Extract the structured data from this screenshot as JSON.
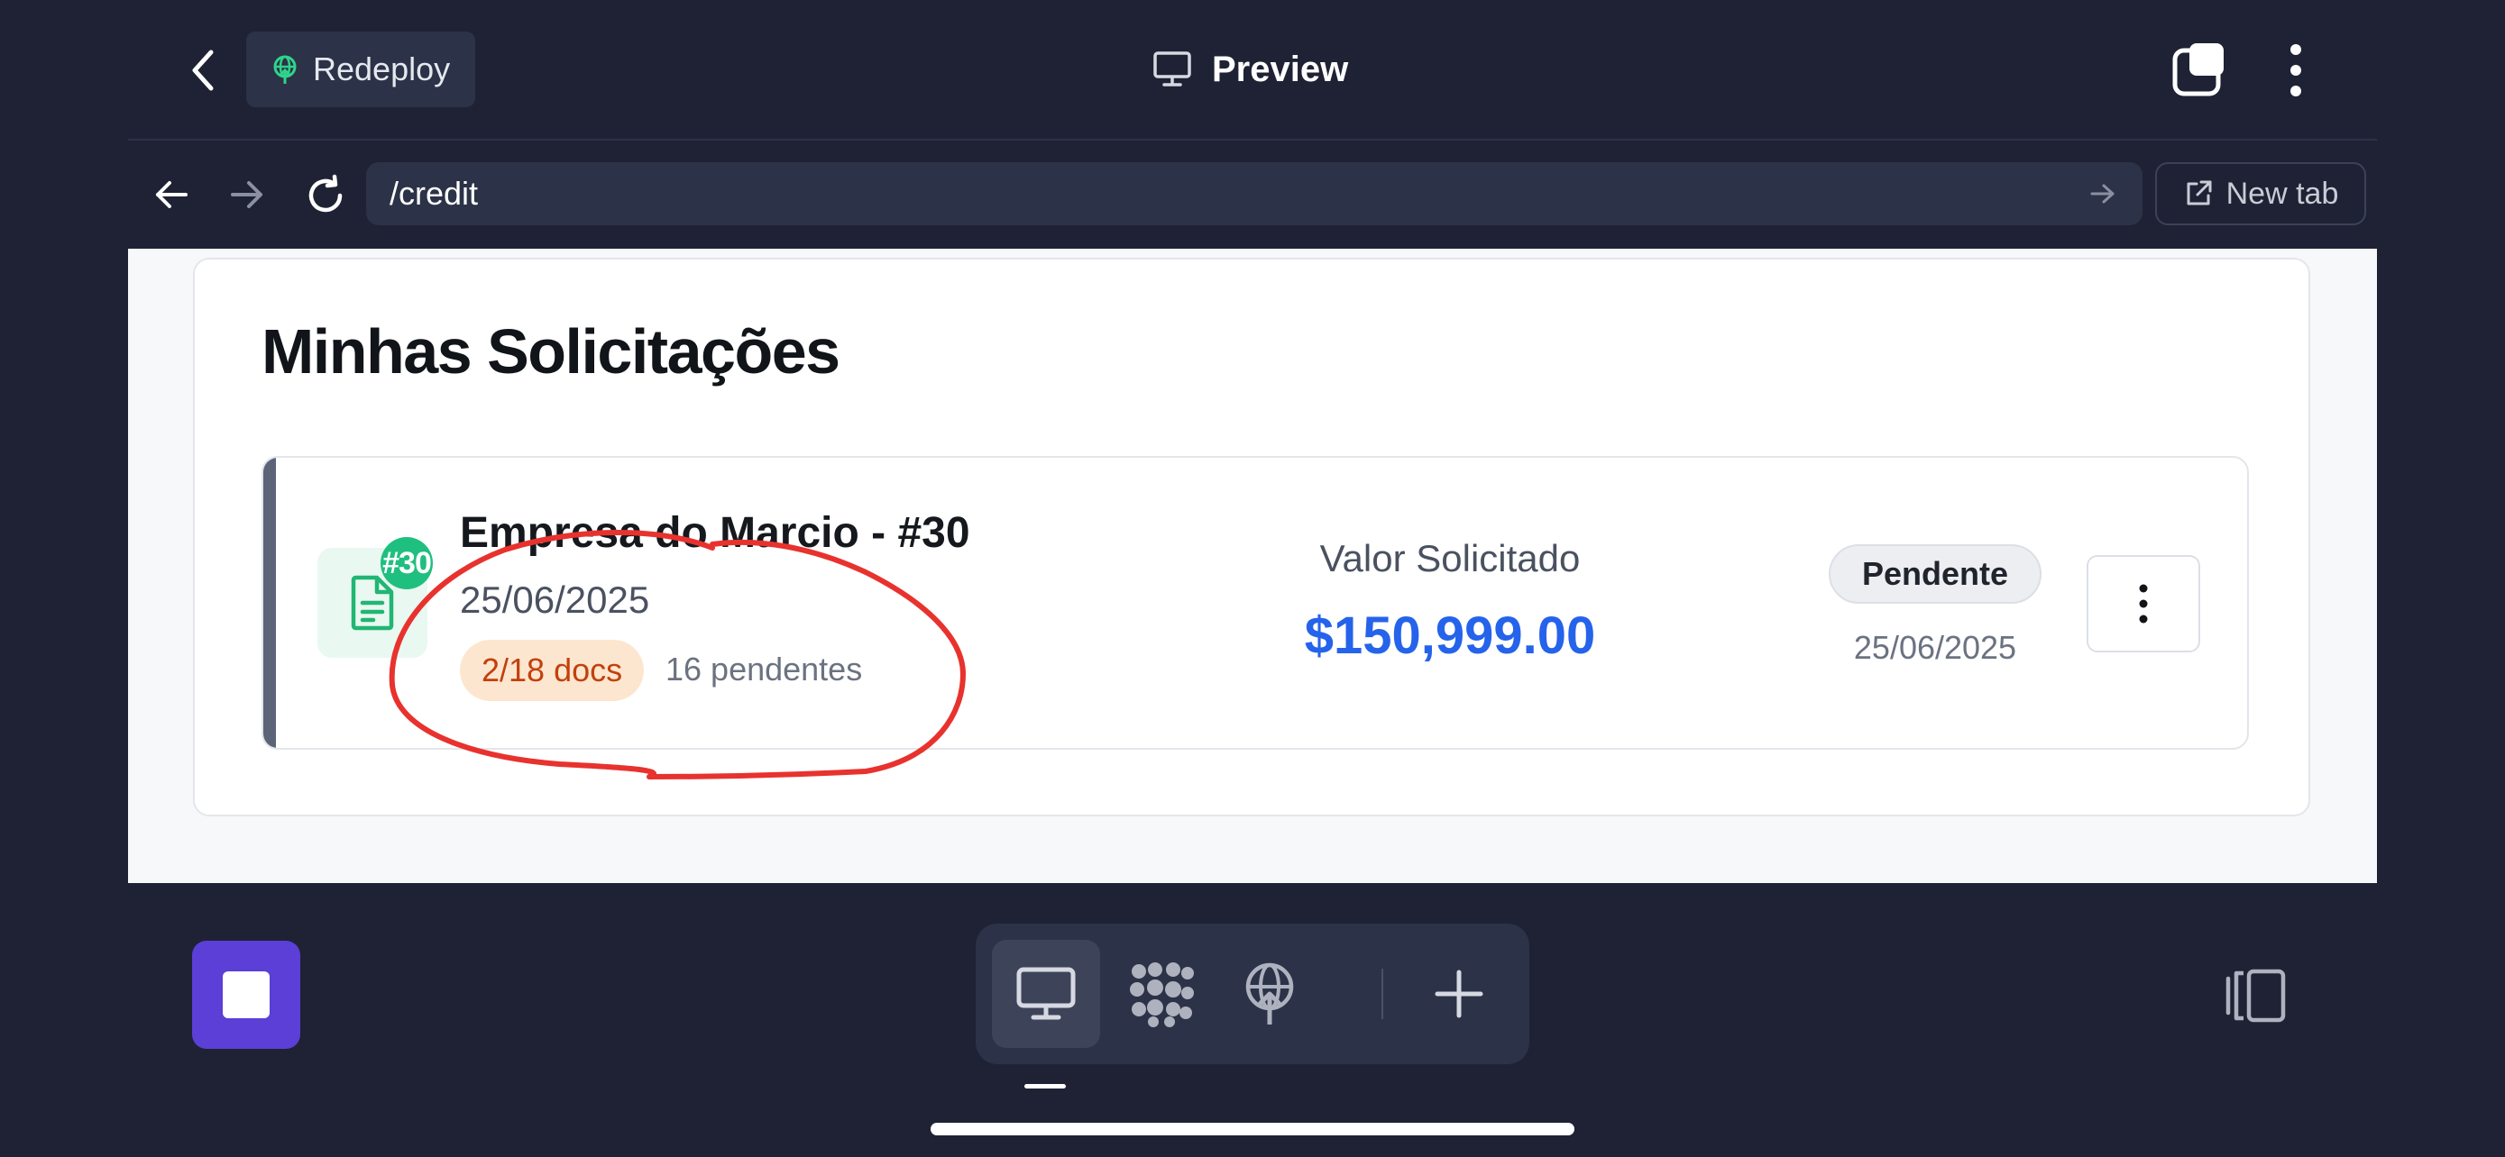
{
  "header": {
    "back_icon": "chevron-left-icon",
    "redeploy_label": "Redeploy",
    "redeploy_icon": "globe-upload-icon",
    "title": "Preview",
    "title_icon": "monitor-icon",
    "tabs_icon": "tabs-icon",
    "more_icon": "more-vertical-icon"
  },
  "nav": {
    "url": "/credit",
    "new_tab_label": "New tab",
    "new_tab_icon": "external-link-icon"
  },
  "page": {
    "title": "Minhas Solicitações",
    "request": {
      "number_badge": "#30",
      "company": "Empresa do Marcio - #30",
      "date": "25/06/2025",
      "docs_badge": "2/18 docs",
      "pending": "16 pendentes",
      "amount_label": "Valor Solicitado",
      "amount": "$150,999.00",
      "status": "Pendente",
      "status_date": "25/06/2025"
    }
  },
  "bottom": {
    "stop_icon": "stop-icon",
    "dock": [
      "monitor-icon",
      "apps-icon",
      "globe-upload-icon",
      "plus-icon"
    ],
    "panel_toggle_icon": "panel-toggle-icon"
  },
  "colors": {
    "background": "#1e2234",
    "surface": "#2c3247",
    "accent_purple": "#5b3fd6",
    "amount_blue": "#2563eb",
    "doc_green": "#1fbf7f",
    "docs_orange": "#c2410c",
    "annotation_red": "#e8322e"
  }
}
